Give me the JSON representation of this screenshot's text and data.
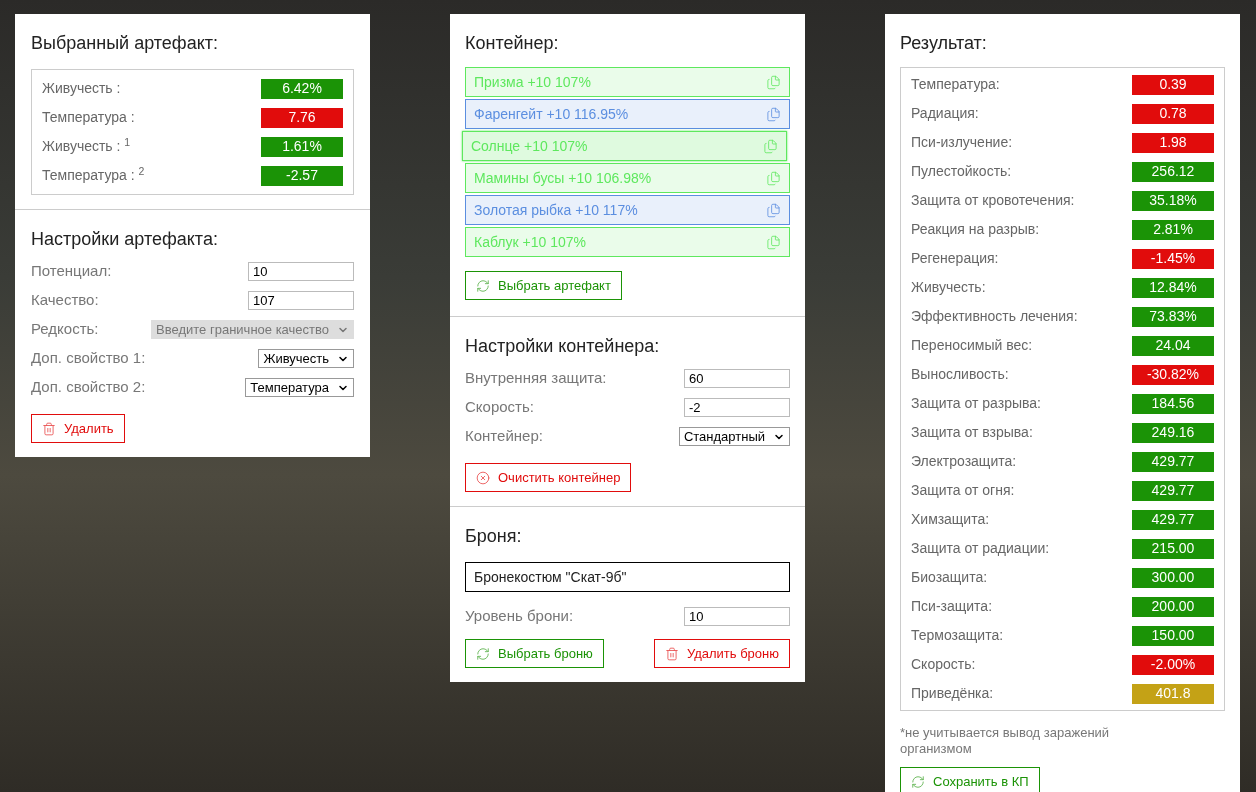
{
  "artifact": {
    "title": "Выбранный артефакт:",
    "stats": [
      {
        "label": "Живучесть :",
        "value": "6.42%",
        "color": "#1b9306"
      },
      {
        "label": "Температура :",
        "value": "7.76",
        "color": "#e10c0c"
      },
      {
        "label": "Живучесть : $^{1}$",
        "value": "1.61%",
        "color": "#1b9306"
      },
      {
        "label": "Температура : $^{2}$",
        "value": "-2.57",
        "color": "#1b9306"
      }
    ]
  },
  "artifact_settings": {
    "title": "Настройки артефакта:",
    "fields": [
      {
        "kind": "input",
        "label": "Потенциал:",
        "value": "10"
      },
      {
        "kind": "input",
        "label": "Качество:",
        "value": "107"
      },
      {
        "kind": "select",
        "label": "Редкость:",
        "value": "Введите граничное качество",
        "disabled": true
      },
      {
        "kind": "select",
        "label": "Доп. свойство 1:",
        "value": "Живучесть",
        "disabled": false
      },
      {
        "kind": "select",
        "label": "Доп. свойство 2:",
        "value": "Температура",
        "disabled": false
      }
    ],
    "delete_button": "Удалить"
  },
  "container": {
    "title": "Контейнер:",
    "items": [
      {
        "label": "Призма +10 107%",
        "color": "#5ee85e",
        "selected": false
      },
      {
        "label": "Фаренгейт +10 116.95%",
        "color": "#5b8ee0",
        "selected": false
      },
      {
        "label": "Солнце +10 107%",
        "color": "#5ee85e",
        "selected": true
      },
      {
        "label": "Мамины бусы +10 106.98%",
        "color": "#5ee85e",
        "selected": false
      },
      {
        "label": "Золотая рыбка +10 117%",
        "color": "#5b8ee0",
        "selected": false
      },
      {
        "label": "Каблук +10 107%",
        "color": "#5ee85e",
        "selected": false
      }
    ],
    "choose_button": "Выбрать артефакт"
  },
  "container_settings": {
    "title": "Настройки контейнера:",
    "fields": [
      {
        "kind": "input",
        "label": "Внутренняя защита:",
        "value": "60"
      },
      {
        "kind": "input",
        "label": "Скорость:",
        "value": "-2"
      },
      {
        "kind": "select",
        "label": "Контейнер:",
        "value": "Стандартный",
        "disabled": false
      }
    ],
    "clear_button": "Очистить контейнер"
  },
  "armor": {
    "title": "Броня:",
    "name": "Бронекостюм \"Скат-9б\"",
    "level_label": "Уровень брони:",
    "level_value": "10",
    "choose_button": "Выбрать броню",
    "delete_button": "Удалить броню"
  },
  "result": {
    "title": "Результат:",
    "stats": [
      {
        "label": "Температура:",
        "value": "0.39",
        "color": "#e10c0c"
      },
      {
        "label": "Радиация:",
        "value": "0.78",
        "color": "#e10c0c"
      },
      {
        "label": "Пси-излучение:",
        "value": "1.98",
        "color": "#e10c0c"
      },
      {
        "label": "Пулестойкость:",
        "value": "256.12",
        "color": "#1b9306"
      },
      {
        "label": "Защита от кровотечения:",
        "value": "35.18%",
        "color": "#1b9306"
      },
      {
        "label": "Реакция на разрыв:",
        "value": "2.81%",
        "color": "#1b9306"
      },
      {
        "label": "Регенерация:",
        "value": "-1.45%",
        "color": "#e10c0c"
      },
      {
        "label": "Живучесть:",
        "value": "12.84%",
        "color": "#1b9306"
      },
      {
        "label": "Эффективность лечения:",
        "value": "73.83%",
        "color": "#1b9306"
      },
      {
        "label": "Переносимый вес:",
        "value": "24.04",
        "color": "#1b9306"
      },
      {
        "label": "Выносливость:",
        "value": "-30.82%",
        "color": "#e10c0c"
      },
      {
        "label": "Защита от разрыва:",
        "value": "184.56",
        "color": "#1b9306"
      },
      {
        "label": "Защита от взрыва:",
        "value": "249.16",
        "color": "#1b9306"
      },
      {
        "label": "Электрозащита:",
        "value": "429.77",
        "color": "#1b9306"
      },
      {
        "label": "Защита от огня:",
        "value": "429.77",
        "color": "#1b9306"
      },
      {
        "label": "Химзащита:",
        "value": "429.77",
        "color": "#1b9306"
      },
      {
        "label": "Защита от радиации:",
        "value": "215.00",
        "color": "#1b9306"
      },
      {
        "label": "Биозащита:",
        "value": "300.00",
        "color": "#1b9306"
      },
      {
        "label": "Пси-защита:",
        "value": "200.00",
        "color": "#1b9306"
      },
      {
        "label": "Термозащита:",
        "value": "150.00",
        "color": "#1b9306"
      },
      {
        "label": "Скорость:",
        "value": "-2.00%",
        "color": "#e10c0c"
      },
      {
        "label": "Приведёнка:",
        "value": "401.8",
        "color": "#c4a216"
      }
    ],
    "note": "*не учитывается вывод заражений организмом",
    "save_button": "Сохранить в КП"
  }
}
